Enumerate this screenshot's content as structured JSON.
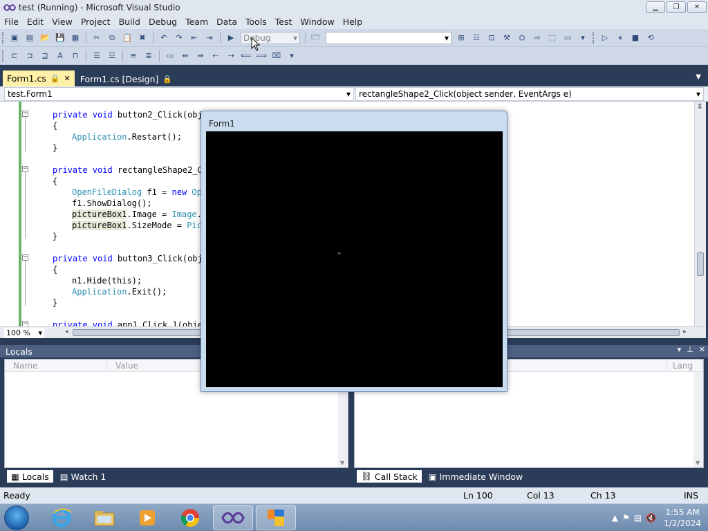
{
  "window": {
    "title": "test (Running) - Microsoft Visual Studio",
    "minimize": "▁",
    "maximize": "❐",
    "close": "✕"
  },
  "menu": [
    "File",
    "Edit",
    "View",
    "Project",
    "Build",
    "Debug",
    "Team",
    "Data",
    "Tools",
    "Test",
    "Window",
    "Help"
  ],
  "toolbar": {
    "config_combo": "Debug",
    "platform_combo": ""
  },
  "tabs": [
    {
      "label": "Form1.cs",
      "pin": "🔒",
      "close": "✕"
    },
    {
      "label": "Form1.cs [Design]",
      "pin": "🔒"
    }
  ],
  "navbar": {
    "class_combo": "test.Form1",
    "member_combo": "rectangleShape2_Click(object sender, EventArgs e)"
  },
  "code": {
    "l1_kw": "private void ",
    "l1_rest": "button2_Click(obje",
    "l2": "{",
    "l3_ty": "Application",
    "l3_rest": ".Restart();",
    "l4": "}",
    "l5_kw": "private void ",
    "l5_rest": "rectangleShape2_Cl",
    "l6": "{",
    "l7_ty": "OpenFileDialog",
    "l7_mid": " f1 = ",
    "l7_kw": "new",
    "l7_ty2": " Ope",
    "l8": "f1.ShowDialog();",
    "l9_hl": "pictureBox1",
    "l9_mid": ".Image = ",
    "l9_ty": "Image",
    "l9_rest": ".F",
    "l10_hl": "pictureBox1",
    "l10_mid": ".SizeMode = ",
    "l10_ty": "Pict",
    "l11": "}",
    "l12_kw": "private void ",
    "l12_rest": "button3_Click(obje",
    "l13": "{",
    "l14": "n1.Hide(this);",
    "l15_ty": "Application",
    "l15_rest": ".Exit();",
    "l16": "}",
    "l17_kw": "private void ",
    "l17_rest": "app1_Click_1(objec"
  },
  "editor": {
    "zoom": "100 %"
  },
  "locals": {
    "title": "Locals",
    "col_name": "Name",
    "col_value": "Value"
  },
  "callstack": {
    "col_lang": "Lang"
  },
  "bottom_tabs_left": [
    "Locals",
    "Watch 1"
  ],
  "bottom_tabs_right": [
    "Call Stack",
    "Immediate Window"
  ],
  "status": {
    "ready": "Ready",
    "ln": "Ln 100",
    "col": "Col 13",
    "ch": "Ch 13",
    "ins": "INS"
  },
  "form1": {
    "title": "Form1"
  },
  "taskbar": {
    "time": "1:55 AM",
    "date": "1/2/2024"
  },
  "colors": {
    "ide_dark": "#2b3c59",
    "active_tab": "#fff0a8",
    "keyword": "#0000ff",
    "type": "#2b91af",
    "change_bar": "#68b368"
  }
}
